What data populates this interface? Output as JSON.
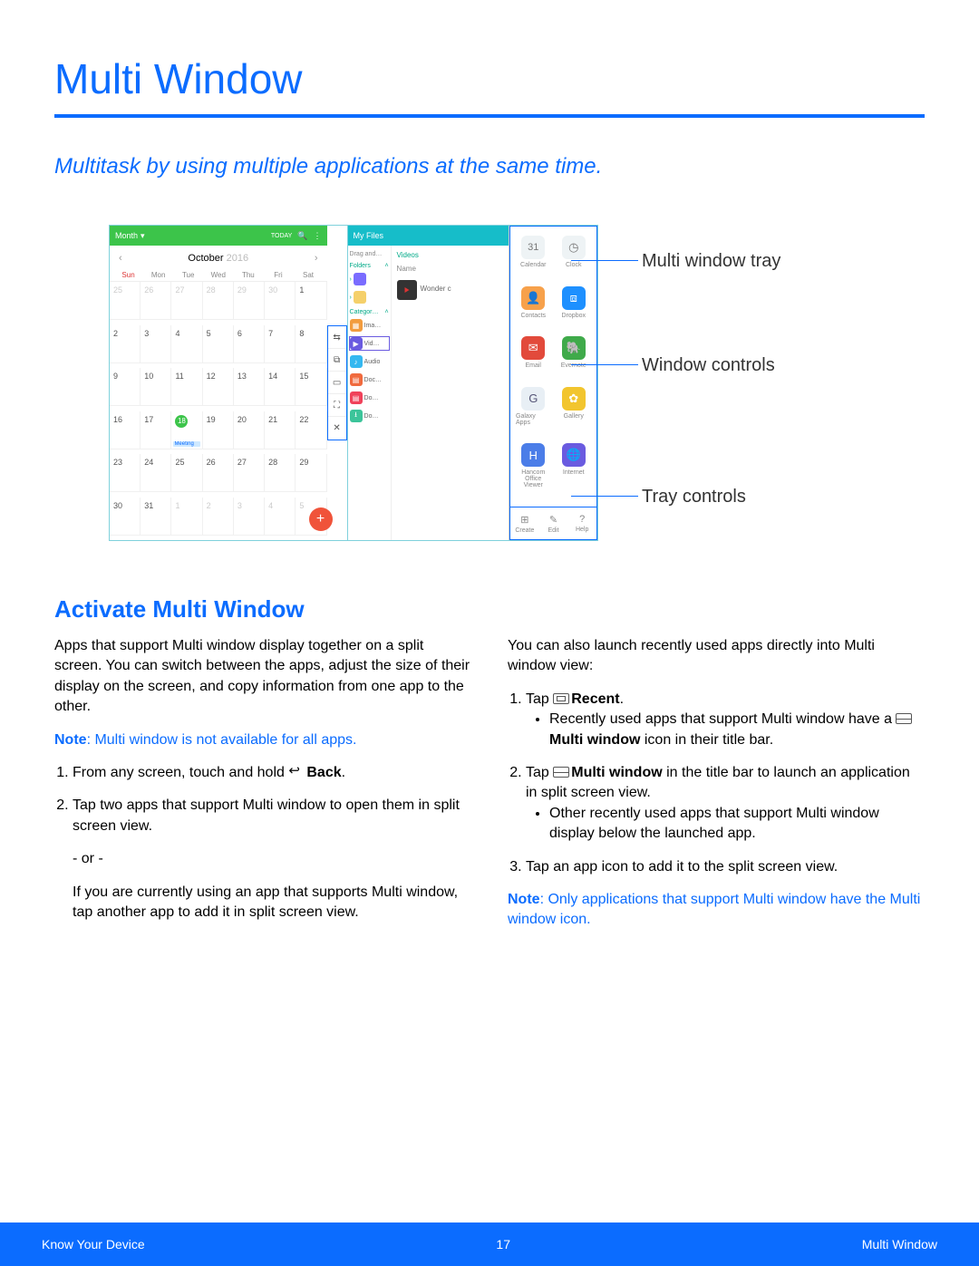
{
  "page": {
    "title": "Multi Window",
    "subtitle": "Multitask by using multiple applications at the same time.",
    "section_title": "Activate Multi Window"
  },
  "annotations": {
    "tray": "Multi window tray",
    "controls": "Window controls",
    "tray_controls": "Tray controls"
  },
  "calendar": {
    "view_label": "Month",
    "today_label": "TODAY",
    "month": "October",
    "year": "2016",
    "dow": [
      "Sun",
      "Mon",
      "Tue",
      "Wed",
      "Thu",
      "Fri",
      "Sat"
    ],
    "prev_days": [
      "25",
      "26",
      "27",
      "28",
      "29",
      "30",
      "1"
    ],
    "weeks": [
      [
        "2",
        "3",
        "4",
        "5",
        "6",
        "7",
        "8"
      ],
      [
        "9",
        "10",
        "11",
        "12",
        "13",
        "14",
        "15"
      ],
      [
        "16",
        "17",
        "18",
        "19",
        "20",
        "21",
        "22"
      ],
      [
        "23",
        "24",
        "25",
        "26",
        "27",
        "28",
        "29"
      ]
    ],
    "next_days": [
      "30",
      "31",
      "1",
      "2",
      "3",
      "4",
      "5"
    ],
    "meeting_label": "Meeting"
  },
  "files": {
    "title": "My Files",
    "drag_label": "Drag and…",
    "folders_label": "Folders",
    "categories_label": "Categor…",
    "videos_label": "Videos",
    "name_label": "Name",
    "item_wonder": "Wonder c",
    "left_items": [
      {
        "label": "Ima…"
      },
      {
        "label": "Vid…"
      },
      {
        "label": "Audio"
      },
      {
        "label": "Doc…"
      },
      {
        "label": "Do…"
      },
      {
        "label": "Do…"
      }
    ]
  },
  "tray_apps": [
    {
      "name": "Calendar",
      "bg": "#eef3f5",
      "glyph": "31"
    },
    {
      "name": "Clock",
      "bg": "#eef3f5",
      "glyph": "◷"
    },
    {
      "name": "Contacts",
      "bg": "#f7a14b",
      "glyph": "👤"
    },
    {
      "name": "Dropbox",
      "bg": "#1e90ff",
      "glyph": "⧈"
    },
    {
      "name": "Email",
      "bg": "#e24a3b",
      "glyph": "✉"
    },
    {
      "name": "Evernote",
      "bg": "#3faa4a",
      "glyph": "🐘"
    },
    {
      "name": "Galaxy Apps",
      "bg": "#e8eff5",
      "glyph": "G"
    },
    {
      "name": "Gallery",
      "bg": "#f2c52e",
      "glyph": "✿"
    },
    {
      "name": "Hancom Office Viewer",
      "bg": "#4b7de8",
      "glyph": "H"
    },
    {
      "name": "Internet",
      "bg": "#6a5be0",
      "glyph": "🌐"
    }
  ],
  "tray_controls": [
    {
      "label": "Create",
      "glyph": "⊞"
    },
    {
      "label": "Edit",
      "glyph": "✎"
    },
    {
      "label": "Help",
      "glyph": "?"
    }
  ],
  "body": {
    "left": {
      "p1": "Apps that support Multi window display together on a split screen. You can switch between the apps, adjust the size of their display on the screen, and copy information from one app to the other.",
      "note_label": "Note",
      "note_text": ": Multi window is not available for all apps.",
      "step1_pre": "From any screen, touch and hold ",
      "step1_bold": "Back",
      "step1_post": ".",
      "step2": "Tap two apps that support Multi window to open them in split screen view.",
      "or": "- or -",
      "or_text": "If you are currently using an app that supports Multi window, tap another app to add it in split screen view."
    },
    "right": {
      "p1": "You can also launch recently used apps directly into Multi window view:",
      "s1_pre": "Tap ",
      "s1_bold": "Recent",
      "s1_post": ".",
      "s1_bullet_pre": "Recently used apps that support Multi window have a ",
      "s1_bullet_bold": "Multi window",
      "s1_bullet_post": " icon in their title bar.",
      "s2_pre": "Tap ",
      "s2_bold": "Multi window",
      "s2_post": " in the title bar to launch an application in split screen view.",
      "s2_bullet": "Other recently used apps that support Multi window display below the launched app.",
      "s3": "Tap an app icon to add it to the split screen view.",
      "note_label": "Note",
      "note_text": ": Only applications that support Multi window have the Multi window icon."
    }
  },
  "footer": {
    "left": "Know Your Device",
    "center": "17",
    "right": "Multi Window"
  }
}
